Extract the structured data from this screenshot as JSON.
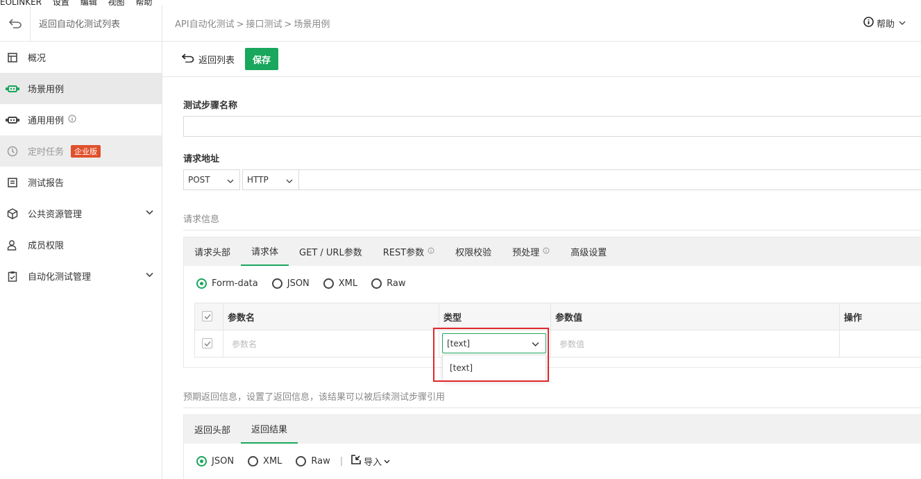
{
  "menubar": {
    "items": [
      "EOLINKER",
      "设置",
      "编辑",
      "视图",
      "帮助"
    ]
  },
  "sidebar": {
    "back_label": "返回自动化测试列表",
    "items": [
      {
        "label": "概况",
        "icon": "dashboard-icon"
      },
      {
        "label": "场景用例",
        "icon": "robot-icon"
      },
      {
        "label": "通用用例",
        "icon": "robot-icon"
      },
      {
        "label": "定时任务",
        "icon": "timer-icon",
        "badge": "企业版"
      },
      {
        "label": "测试报告",
        "icon": "report-icon"
      },
      {
        "label": "公共资源管理",
        "icon": "cube-icon"
      },
      {
        "label": "成员权限",
        "icon": "user-icon"
      },
      {
        "label": "自动化测试管理",
        "icon": "clipboard-icon"
      }
    ]
  },
  "header": {
    "breadcrumb": [
      "API自动化测试",
      "接口测试",
      "场景用例"
    ],
    "help_label": "帮助"
  },
  "toolbar": {
    "back_label": "返回列表",
    "save_label": "保存"
  },
  "form": {
    "step_name_label": "测试步骤名称",
    "url_label": "请求地址",
    "method": "POST",
    "protocol": "HTTP"
  },
  "request": {
    "section_label": "请求信息",
    "tabs": [
      "请求头部",
      "请求体",
      "GET / URL参数",
      "REST参数",
      "权限校验",
      "预处理",
      "高级设置"
    ],
    "body_types": [
      "Form-data",
      "JSON",
      "XML",
      "Raw"
    ],
    "table": {
      "headers": [
        "参数名",
        "类型",
        "参数值",
        "操作"
      ],
      "row": {
        "name_placeholder": "参数名",
        "type_value": "[text]",
        "value_placeholder": "参数值"
      }
    },
    "type_options": [
      "[text]"
    ]
  },
  "response": {
    "section_label": "预期返回信息，设置了返回信息，该结果可以被后续测试步骤引用",
    "tabs": [
      "返回头部",
      "返回结果"
    ],
    "formats": [
      "JSON",
      "XML",
      "Raw"
    ],
    "import_label": "导入"
  },
  "colors": {
    "accent": "#19a65d",
    "badge": "#e0502b",
    "highlight": "#e0262b"
  }
}
